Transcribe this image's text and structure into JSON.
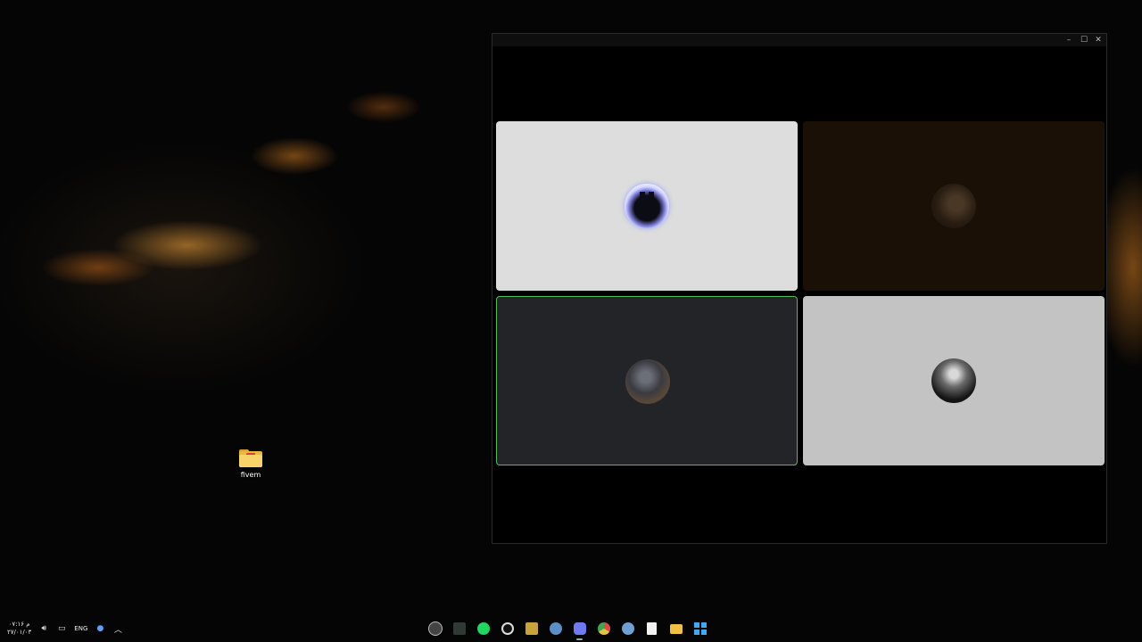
{
  "desktop": {
    "icons": [
      {
        "label": "fivem",
        "icon": "folder-icon"
      }
    ]
  },
  "window": {
    "controls": {
      "minimize": "–",
      "maximize": "☐",
      "close": "✕"
    },
    "tiles": [
      {
        "avatar": "batman-avatar",
        "bg": "#dcdddc",
        "speaking": false
      },
      {
        "avatar": "man-portrait-avatar",
        "bg": "#1a1006",
        "speaking": false
      },
      {
        "avatar": "landscape-avatar",
        "bg": "#232427",
        "speaking": true
      },
      {
        "avatar": "crowd-avatar",
        "bg": "#c3c3c3",
        "speaking": false
      }
    ]
  },
  "taskbar": {
    "tray": {
      "time": "۰۷:۱۶ م",
      "date": "۲۷/۰۱/۰۳",
      "language": "ENG"
    },
    "apps": [
      {
        "name": "clock-app-icon",
        "color": "#444"
      },
      {
        "name": "terminal-app-icon",
        "color": "#2f3a35"
      },
      {
        "name": "spotify-icon",
        "color": "#1ed760"
      },
      {
        "name": "obs-icon",
        "color": "#dddddd"
      },
      {
        "name": "battlenet-icon",
        "color": "#c8a23a"
      },
      {
        "name": "steam-icon-1",
        "color": "#5b8fc7"
      },
      {
        "name": "discord-icon",
        "color": "#6f79f2"
      },
      {
        "name": "chrome-icon",
        "color": "#e3c33c"
      },
      {
        "name": "steam-icon-2",
        "color": "#6fa0d4"
      },
      {
        "name": "notepad-icon",
        "color": "#f2f2f2"
      },
      {
        "name": "file-explorer-icon",
        "color": "#f0c040"
      },
      {
        "name": "windows-start-icon",
        "color": "#3fa9f5"
      }
    ]
  }
}
